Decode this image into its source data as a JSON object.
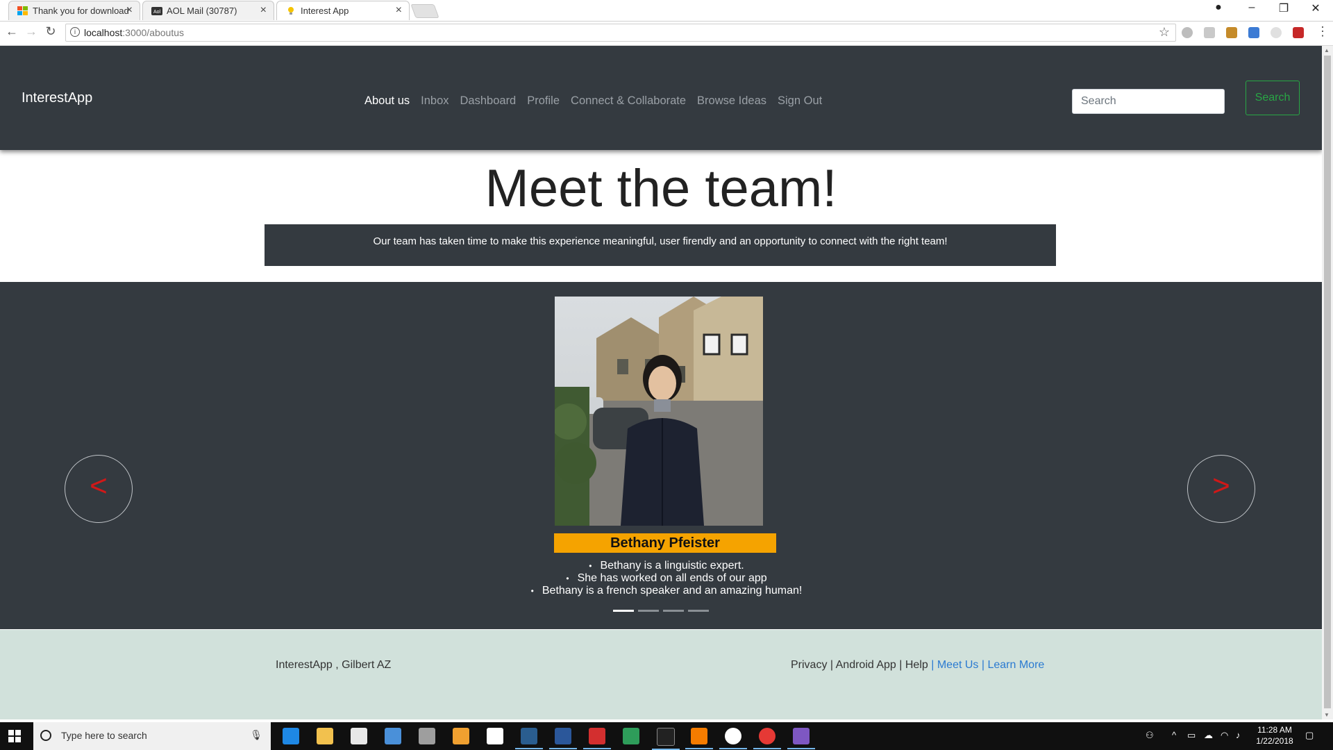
{
  "browser": {
    "tabs": [
      {
        "title": "Thank you for download",
        "active": false
      },
      {
        "title": "AOL Mail (30787)",
        "active": false
      },
      {
        "title": "Interest App",
        "active": true
      }
    ],
    "url": {
      "host": "localhost",
      "path": ":3000/aboutus"
    }
  },
  "navbar": {
    "brand": "InterestApp",
    "links": [
      "About us",
      "Inbox",
      "Dashboard",
      "Profile",
      "Connect & Collaborate",
      "Browse Ideas",
      "Sign Out"
    ],
    "active_link": "About us",
    "search_placeholder": "Search",
    "search_button": "Search"
  },
  "hero": {
    "title": "Meet the team!",
    "intro": "Our team has taken time to make this experience meaningful, user firendly and an opportunity to connect with the right team!"
  },
  "carousel": {
    "prev_label": "<",
    "next_label": ">",
    "member": {
      "name": "Bethany Pfeister",
      "facts": [
        "Bethany is a linguistic expert.",
        "She has worked on all ends of our app",
        "Bethany is a french speaker and an amazing human!"
      ]
    },
    "slide_count": 4,
    "active_slide": 1
  },
  "footer": {
    "left": "InterestApp , Gilbert AZ",
    "links": [
      {
        "label": "Privacy",
        "highlight": false
      },
      {
        "label": "Android App",
        "highlight": false
      },
      {
        "label": "Help",
        "highlight": false
      },
      {
        "label": "Meet Us",
        "highlight": true
      },
      {
        "label": "Learn More",
        "highlight": true
      }
    ],
    "separator": "|"
  },
  "taskbar": {
    "search_placeholder": "Type here to search",
    "time": "11:28 AM",
    "date": "1/22/2018"
  },
  "colors": {
    "navbar_bg": "#343a40",
    "accent_green": "#28a745",
    "name_bar": "#f5a300",
    "caret_red": "#d01818",
    "footer_bg": "#d1e1db",
    "link_blue": "#2a7ad1"
  }
}
